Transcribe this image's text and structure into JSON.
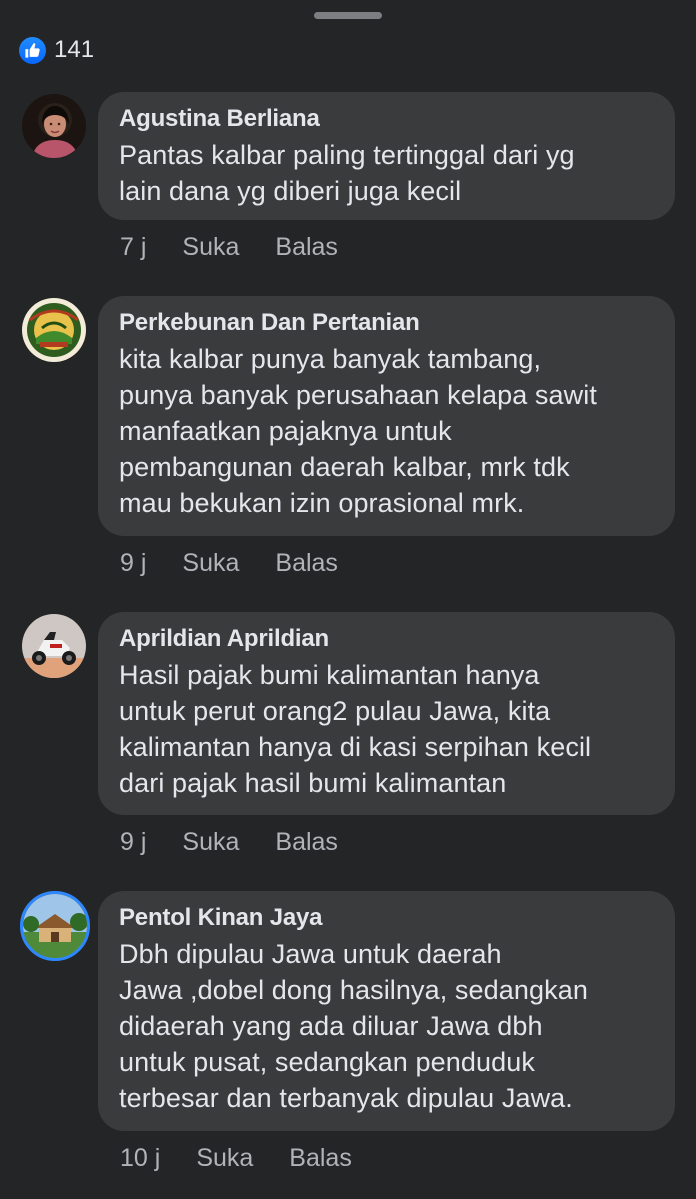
{
  "reactions": {
    "icon": "thumbs-up-icon",
    "count": "141",
    "accent": "#0866ff"
  },
  "comments": [
    {
      "author": "Agustina Berliana",
      "text": "Pantas kalbar paling tertinggal dari yg\nlain dana yg diberi juga kecil",
      "time": "7 j",
      "like_label": "Suka",
      "reply_label": "Balas"
    },
    {
      "author": "Perkebunan Dan Pertanian",
      "text": "kita kalbar punya banyak tambang,\npunya banyak perusahaan kelapa sawit\nmanfaatkan pajaknya untuk\npembangunan daerah kalbar, mrk tdk\nmau bekukan izin oprasional mrk.",
      "time": "9 j",
      "like_label": "Suka",
      "reply_label": "Balas"
    },
    {
      "author": "Aprildian Aprildian",
      "text": "Hasil pajak bumi kalimantan hanya\nuntuk perut orang2 pulau Jawa, kita\nkalimantan hanya di kasi serpihan kecil\ndari pajak hasil bumi kalimantan",
      "time": "9 j",
      "like_label": "Suka",
      "reply_label": "Balas"
    },
    {
      "author": "Pentol Kinan Jaya",
      "text": "Dbh dipulau Jawa untuk daerah\nJawa ,dobel dong hasilnya, sedangkan\ndidaerah yang ada diluar Jawa dbh\nuntuk pusat, sedangkan penduduk\nterbesar dan terbanyak dipulau Jawa.",
      "time": "10 j",
      "like_label": "Suka",
      "reply_label": "Balas"
    }
  ],
  "colors": {
    "background": "#242526",
    "bubble": "#3a3b3c",
    "primary_text": "#e4e6eb",
    "secondary_text": "#b0b3b8",
    "story_ring": "#2d88ff"
  }
}
